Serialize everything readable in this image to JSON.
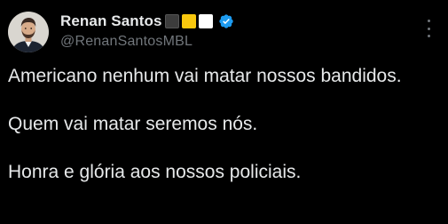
{
  "tweet": {
    "author": {
      "name": "Renan Santos",
      "handle": "@RenanSantosMBL",
      "name_emojis": [
        {
          "icon": "black-square-emoji",
          "color": "#3c3c3c"
        },
        {
          "icon": "yellow-square-emoji",
          "color": "#f9c80e"
        },
        {
          "icon": "white-square-emoji",
          "color": "#ffffff"
        }
      ],
      "verified_color": "#1d9bf0"
    },
    "body": {
      "line1": "Americano nenhum vai matar nossos bandidos.",
      "line2": "Quem vai matar seremos nós.",
      "line3": "Honra e glória aos nossos policiais."
    },
    "more_icon": "more-options-icon"
  }
}
